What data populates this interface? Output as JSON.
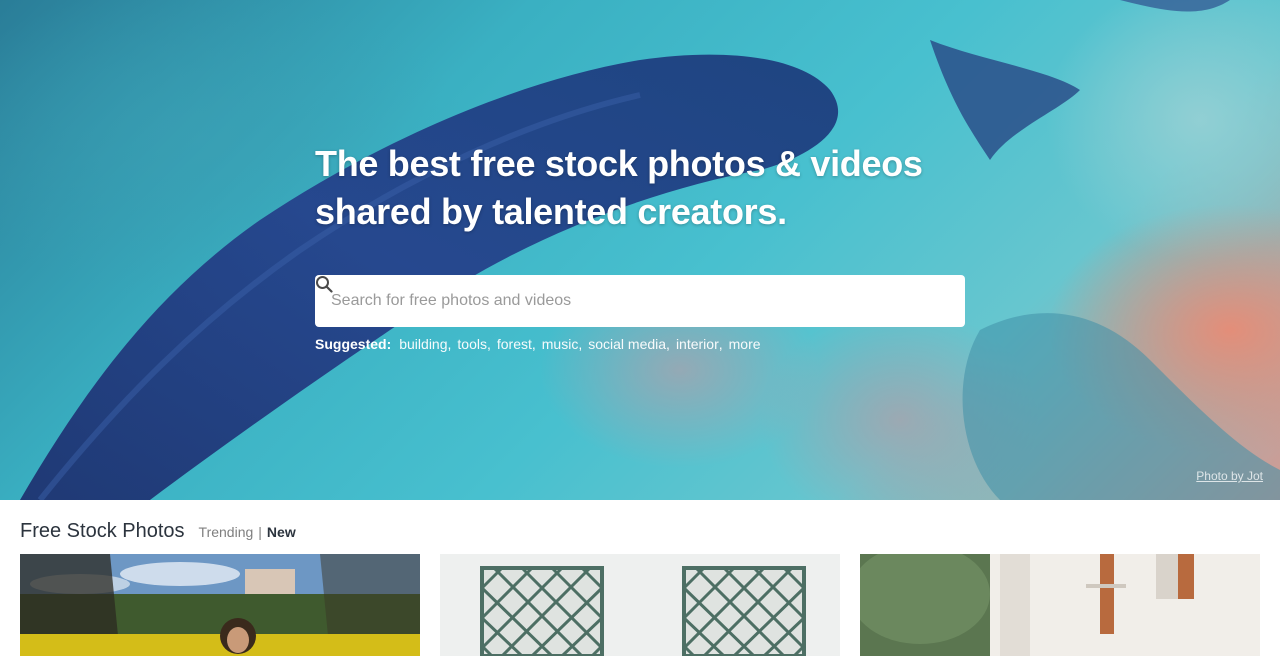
{
  "hero": {
    "headline_line1": "The best free stock photos & videos",
    "headline_line2": "shared by talented creators.",
    "search_placeholder": "Search for free photos and videos",
    "suggested_label": "Suggested:",
    "suggested_tags": [
      "building",
      "tools",
      "forest",
      "music",
      "social media",
      "interior",
      "more"
    ],
    "credit": "Photo by Jot"
  },
  "gallery": {
    "title": "Free Stock Photos",
    "tab_trending": "Trending",
    "tab_new": "New",
    "active_tab": "New"
  },
  "icons": {
    "search": "search-icon"
  },
  "colors": {
    "accent_text": "#2c343e",
    "muted_text": "#7f7f7f"
  }
}
